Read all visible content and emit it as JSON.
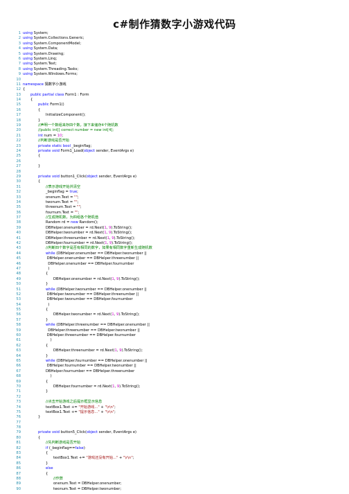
{
  "document": {
    "title": "c#制作猜数字小游戏代码"
  },
  "colors": {
    "keyword": "#0000ff",
    "comment": "#008000",
    "string": "#a31515",
    "number": "#cc00cc",
    "line_number": "#2b91af"
  },
  "code_lines": [
    {
      "n": "1",
      "indent": 0,
      "segs": [
        {
          "t": "kw",
          "v": "using"
        },
        {
          "t": "p",
          "v": " System;"
        }
      ]
    },
    {
      "n": "2",
      "indent": 0,
      "segs": [
        {
          "t": "kw",
          "v": "using"
        },
        {
          "t": "p",
          "v": " System.Collections.Generic;"
        }
      ]
    },
    {
      "n": "3",
      "indent": 0,
      "segs": [
        {
          "t": "kw",
          "v": "using"
        },
        {
          "t": "p",
          "v": " System.ComponentModel;"
        }
      ]
    },
    {
      "n": "4",
      "indent": 0,
      "segs": [
        {
          "t": "kw",
          "v": "using"
        },
        {
          "t": "p",
          "v": " System.Data;"
        }
      ]
    },
    {
      "n": "5",
      "indent": 0,
      "segs": [
        {
          "t": "kw",
          "v": "using"
        },
        {
          "t": "p",
          "v": " System.Drawing;"
        }
      ]
    },
    {
      "n": "6",
      "indent": 0,
      "segs": [
        {
          "t": "kw",
          "v": "using"
        },
        {
          "t": "p",
          "v": " System.Linq;"
        }
      ]
    },
    {
      "n": "7",
      "indent": 0,
      "segs": [
        {
          "t": "kw",
          "v": "using"
        },
        {
          "t": "p",
          "v": " System.Text;"
        }
      ]
    },
    {
      "n": "8",
      "indent": 0,
      "segs": [
        {
          "t": "kw",
          "v": "using"
        },
        {
          "t": "p",
          "v": " System.Threading.Tasks;"
        }
      ]
    },
    {
      "n": "9",
      "indent": 0,
      "segs": [
        {
          "t": "kw",
          "v": "using"
        },
        {
          "t": "p",
          "v": " System.Windows.Forms;"
        }
      ]
    },
    {
      "n": "10",
      "indent": 0,
      "segs": []
    },
    {
      "n": "11",
      "indent": 0,
      "segs": [
        {
          "t": "kw",
          "v": "namespace"
        },
        {
          "t": "p",
          "v": " 猜数字小游戏"
        }
      ]
    },
    {
      "n": "12",
      "indent": 0,
      "segs": [
        {
          "t": "p",
          "v": "{"
        }
      ]
    },
    {
      "n": "13",
      "indent": 1,
      "segs": [
        {
          "t": "kw",
          "v": "public partial class"
        },
        {
          "t": "p",
          "v": " Form1 : Form"
        }
      ]
    },
    {
      "n": "14",
      "indent": 1,
      "segs": [
        {
          "t": "p",
          "v": "{"
        }
      ]
    },
    {
      "n": "15",
      "indent": 2,
      "segs": [
        {
          "t": "kw",
          "v": "public"
        },
        {
          "t": "p",
          "v": " Form1()"
        }
      ]
    },
    {
      "n": "16",
      "indent": 2,
      "segs": [
        {
          "t": "p",
          "v": "{"
        }
      ]
    },
    {
      "n": "17",
      "indent": 3,
      "segs": [
        {
          "t": "p",
          "v": "InitializeComponent();"
        }
      ]
    },
    {
      "n": "18",
      "indent": 2,
      "segs": [
        {
          "t": "p",
          "v": "}"
        }
      ]
    },
    {
      "n": "19",
      "indent": 2,
      "segs": [
        {
          "t": "cm",
          "v": "//声明一个数组来存四个数，接下来储存4个随机数"
        }
      ]
    },
    {
      "n": "20",
      "indent": 2,
      "segs": [
        {
          "t": "cm",
          "v": "//public int[] correct number = new int[4];"
        }
      ]
    },
    {
      "n": "21",
      "indent": 2,
      "segs": [
        {
          "t": "kw",
          "v": "int"
        },
        {
          "t": "p",
          "v": " num = "
        },
        {
          "t": "num",
          "v": "10"
        },
        {
          "t": "p",
          "v": ";"
        }
      ]
    },
    {
      "n": "22",
      "indent": 2,
      "segs": [
        {
          "t": "cm",
          "v": "//判断游戏是否开始"
        }
      ]
    },
    {
      "n": "23",
      "indent": 2,
      "segs": [
        {
          "t": "kw",
          "v": "private static bool"
        },
        {
          "t": "p",
          "v": " _beginflag;"
        }
      ]
    },
    {
      "n": "24",
      "indent": 2,
      "segs": [
        {
          "t": "kw",
          "v": "private void"
        },
        {
          "t": "p",
          "v": " Form1_Load("
        },
        {
          "t": "kw",
          "v": "object"
        },
        {
          "t": "p",
          "v": " sender, EventArgs e)"
        }
      ]
    },
    {
      "n": "25",
      "indent": 2,
      "segs": [
        {
          "t": "p",
          "v": "{"
        }
      ]
    },
    {
      "n": "26",
      "indent": 0,
      "segs": []
    },
    {
      "n": "27",
      "indent": 2,
      "segs": [
        {
          "t": "p",
          "v": "}"
        }
      ]
    },
    {
      "n": "28",
      "indent": 0,
      "segs": []
    },
    {
      "n": "29",
      "indent": 2,
      "segs": [
        {
          "t": "kw",
          "v": "private void"
        },
        {
          "t": "p",
          "v": " button1_Click("
        },
        {
          "t": "kw",
          "v": "object"
        },
        {
          "t": "p",
          "v": " sender, EventArgs e)"
        }
      ]
    },
    {
      "n": "30",
      "indent": 2,
      "segs": [
        {
          "t": "p",
          "v": "{"
        }
      ]
    },
    {
      "n": "31",
      "indent": 3,
      "segs": [
        {
          "t": "cm",
          "v": "//表示游戏开始并清空"
        }
      ]
    },
    {
      "n": "32",
      "indent": 3,
      "segs": [
        {
          "t": "p",
          "v": "_beginflag = "
        },
        {
          "t": "kw",
          "v": "true"
        },
        {
          "t": "p",
          "v": ";"
        }
      ]
    },
    {
      "n": "33",
      "indent": 3,
      "segs": [
        {
          "t": "p",
          "v": "onenum.Text = "
        },
        {
          "t": "str",
          "v": "\"\""
        },
        {
          "t": "p",
          "v": ";"
        }
      ]
    },
    {
      "n": "34",
      "indent": 3,
      "segs": [
        {
          "t": "p",
          "v": "twonum.Text = "
        },
        {
          "t": "str",
          "v": "\"\""
        },
        {
          "t": "p",
          "v": ";"
        }
      ]
    },
    {
      "n": "35",
      "indent": 3,
      "segs": [
        {
          "t": "p",
          "v": "threenum.Text = "
        },
        {
          "t": "str",
          "v": "\"\""
        },
        {
          "t": "p",
          "v": ";"
        }
      ]
    },
    {
      "n": "36",
      "indent": 3,
      "segs": [
        {
          "t": "p",
          "v": "fournum.Text = "
        },
        {
          "t": "str",
          "v": "\"\""
        },
        {
          "t": "p",
          "v": ";"
        }
      ]
    },
    {
      "n": "37",
      "indent": 3,
      "segs": [
        {
          "t": "cm",
          "v": "//生成随机数，为四组各个随机值"
        }
      ]
    },
    {
      "n": "38",
      "indent": 3,
      "segs": [
        {
          "t": "p",
          "v": "Random rd = "
        },
        {
          "t": "kw",
          "v": "new"
        },
        {
          "t": "p",
          "v": " Random();"
        }
      ]
    },
    {
      "n": "39",
      "indent": 3,
      "segs": [
        {
          "t": "p",
          "v": "DBHelper.onenumber = rd.Next("
        },
        {
          "t": "num",
          "v": "1"
        },
        {
          "t": "p",
          "v": ", "
        },
        {
          "t": "num",
          "v": "9"
        },
        {
          "t": "p",
          "v": ").ToString();"
        }
      ]
    },
    {
      "n": "40",
      "indent": 3,
      "segs": [
        {
          "t": "p",
          "v": "DBHelper.twonumber = rd.Next("
        },
        {
          "t": "num",
          "v": "1"
        },
        {
          "t": "p",
          "v": ", "
        },
        {
          "t": "num",
          "v": "9"
        },
        {
          "t": "p",
          "v": ").ToString();"
        }
      ]
    },
    {
      "n": "41",
      "indent": 3,
      "segs": [
        {
          "t": "p",
          "v": "DBHelper.threenumber = rd.Next("
        },
        {
          "t": "num",
          "v": "1"
        },
        {
          "t": "p",
          "v": ", "
        },
        {
          "t": "num",
          "v": "9"
        },
        {
          "t": "p",
          "v": ").ToString();"
        }
      ]
    },
    {
      "n": "42",
      "indent": 3,
      "segs": [
        {
          "t": "p",
          "v": "DBHelper.fournumber = rd.Next("
        },
        {
          "t": "num",
          "v": "1"
        },
        {
          "t": "p",
          "v": ", "
        },
        {
          "t": "num",
          "v": "9"
        },
        {
          "t": "p",
          "v": ").ToString();"
        }
      ]
    },
    {
      "n": "43",
      "indent": 3,
      "segs": [
        {
          "t": "cm",
          "v": "//判断四个数字是否有相同的数字，如果有相同数字重新生成随机数"
        }
      ]
    },
    {
      "n": "44",
      "indent": 3,
      "segs": [
        {
          "t": "kw",
          "v": "while"
        },
        {
          "t": "p",
          "v": " (DBHelper.onenumber == DBHelper.twonumber ||"
        }
      ]
    },
    {
      "n": "45",
      "indent": 3,
      "segs": [
        {
          "t": "p",
          "v": " DBHelper.onenumber == DBHelper.threenumber ||"
        }
      ]
    },
    {
      "n": "46",
      "indent": 3,
      "segs": [
        {
          "t": "p",
          "v": "  DBHelper.onenumber == DBHelper.fournumber"
        }
      ]
    },
    {
      "n": "47",
      "indent": 3,
      "segs": [
        {
          "t": "p",
          "v": "  )"
        }
      ]
    },
    {
      "n": "48",
      "indent": 3,
      "segs": [
        {
          "t": "p",
          "v": "{"
        }
      ]
    },
    {
      "n": "49",
      "indent": 4,
      "segs": [
        {
          "t": "p",
          "v": "DBHelper.onenumber = rd.Next("
        },
        {
          "t": "num",
          "v": "1"
        },
        {
          "t": "p",
          "v": ", "
        },
        {
          "t": "num",
          "v": "9"
        },
        {
          "t": "p",
          "v": ").ToString();"
        }
      ]
    },
    {
      "n": "50",
      "indent": 3,
      "segs": [
        {
          "t": "p",
          "v": "}"
        }
      ]
    },
    {
      "n": "51",
      "indent": 3,
      "segs": [
        {
          "t": "kw",
          "v": "while"
        },
        {
          "t": "p",
          "v": " (DBHelper.twonumber == DBHelper.onenumber ||"
        }
      ]
    },
    {
      "n": "52",
      "indent": 3,
      "segs": [
        {
          "t": "p",
          "v": " DBHelper.twonumber == DBHelper.threenumber ||"
        }
      ]
    },
    {
      "n": "53",
      "indent": 3,
      "segs": [
        {
          "t": "p",
          "v": " DBHelper.twonumber == DBHelper.fournumber"
        }
      ]
    },
    {
      "n": "54",
      "indent": 3,
      "segs": [
        {
          "t": "p",
          "v": "  )"
        }
      ]
    },
    {
      "n": "55",
      "indent": 3,
      "segs": [
        {
          "t": "p",
          "v": "{"
        }
      ]
    },
    {
      "n": "56",
      "indent": 4,
      "segs": [
        {
          "t": "p",
          "v": "DBHelper.twonumber = rd.Next("
        },
        {
          "t": "num",
          "v": "1"
        },
        {
          "t": "p",
          "v": ", "
        },
        {
          "t": "num",
          "v": "9"
        },
        {
          "t": "p",
          "v": ").ToString();"
        }
      ]
    },
    {
      "n": "57",
      "indent": 3,
      "segs": [
        {
          "t": "p",
          "v": "}"
        }
      ]
    },
    {
      "n": "58",
      "indent": 3,
      "segs": [
        {
          "t": "kw",
          "v": "while"
        },
        {
          "t": "p",
          "v": " (DBHelper.threenumber == DBHelper.onenumber ||"
        }
      ]
    },
    {
      "n": "59",
      "indent": 3,
      "segs": [
        {
          "t": "p",
          "v": "  DBHelper.threenumber == DBHelper.twonumber ||"
        }
      ]
    },
    {
      "n": "60",
      "indent": 3,
      "segs": [
        {
          "t": "p",
          "v": " DBHelper.threenumber == DBHelper.fournumber"
        }
      ]
    },
    {
      "n": "61",
      "indent": 3,
      "segs": [
        {
          "t": "p",
          "v": "    )"
        }
      ]
    },
    {
      "n": "62",
      "indent": 3,
      "segs": [
        {
          "t": "p",
          "v": "{"
        }
      ]
    },
    {
      "n": "63",
      "indent": 4,
      "segs": [
        {
          "t": "p",
          "v": "DBHelper.threenumber = rd.Next("
        },
        {
          "t": "num",
          "v": "1"
        },
        {
          "t": "p",
          "v": ", "
        },
        {
          "t": "num",
          "v": "9"
        },
        {
          "t": "p",
          "v": ").ToString();"
        }
      ]
    },
    {
      "n": "64",
      "indent": 3,
      "segs": [
        {
          "t": "p",
          "v": "}"
        }
      ]
    },
    {
      "n": "65",
      "indent": 3,
      "segs": [
        {
          "t": "kw",
          "v": "while"
        },
        {
          "t": "p",
          "v": " (DBHelper.fournumber == DBHelper.onenumber ||"
        }
      ]
    },
    {
      "n": "66",
      "indent": 3,
      "segs": [
        {
          "t": "p",
          "v": " DBHelper.fournumber == DBHelper.twonumber ||"
        }
      ]
    },
    {
      "n": "67",
      "indent": 3,
      "segs": [
        {
          "t": "p",
          "v": "DBHelper.fournumber == DBHelper.threenumber"
        }
      ]
    },
    {
      "n": "68",
      "indent": 3,
      "segs": [
        {
          "t": "p",
          "v": "    )"
        }
      ]
    },
    {
      "n": "69",
      "indent": 3,
      "segs": [
        {
          "t": "p",
          "v": "{"
        }
      ]
    },
    {
      "n": "70",
      "indent": 4,
      "segs": [
        {
          "t": "p",
          "v": "DBHelper.fournumber = rd.Next("
        },
        {
          "t": "num",
          "v": "1"
        },
        {
          "t": "p",
          "v": ", "
        },
        {
          "t": "num",
          "v": "9"
        },
        {
          "t": "p",
          "v": ").ToString();"
        }
      ]
    },
    {
      "n": "71",
      "indent": 3,
      "segs": [
        {
          "t": "p",
          "v": "}"
        }
      ]
    },
    {
      "n": "72",
      "indent": 0,
      "segs": []
    },
    {
      "n": "73",
      "indent": 3,
      "segs": [
        {
          "t": "cm",
          "v": "//点击开始游戏之后提示框显示信息"
        }
      ]
    },
    {
      "n": "74",
      "indent": 3,
      "segs": [
        {
          "t": "p",
          "v": "textBox1.Text += "
        },
        {
          "t": "str",
          "v": "\"开始游戏...\""
        },
        {
          "t": "p",
          "v": " + "
        },
        {
          "t": "str",
          "v": "\"\\r\\n\""
        },
        {
          "t": "p",
          "v": ";"
        }
      ]
    },
    {
      "n": "75",
      "indent": 3,
      "segs": [
        {
          "t": "p",
          "v": "textBox1.Text += "
        },
        {
          "t": "str",
          "v": "\"提示信息...\""
        },
        {
          "t": "p",
          "v": " + "
        },
        {
          "t": "str",
          "v": "\"\\r\\n\""
        },
        {
          "t": "p",
          "v": ";"
        }
      ]
    },
    {
      "n": "76",
      "indent": 2,
      "segs": [
        {
          "t": "p",
          "v": "}"
        }
      ]
    },
    {
      "n": "77",
      "indent": 0,
      "segs": []
    },
    {
      "n": "78",
      "indent": 0,
      "segs": []
    },
    {
      "n": "79",
      "indent": 2,
      "segs": [
        {
          "t": "kw",
          "v": "private void"
        },
        {
          "t": "p",
          "v": " button5_Click("
        },
        {
          "t": "kw",
          "v": "object"
        },
        {
          "t": "p",
          "v": " sender, EventArgs e)"
        }
      ]
    },
    {
      "n": "80",
      "indent": 2,
      "segs": [
        {
          "t": "p",
          "v": "{"
        }
      ]
    },
    {
      "n": "81",
      "indent": 3,
      "segs": [
        {
          "t": "cm",
          "v": "//先判断游戏是否开始"
        }
      ]
    },
    {
      "n": "82",
      "indent": 3,
      "segs": [
        {
          "t": "kw",
          "v": "if"
        },
        {
          "t": "p",
          "v": " (_beginflag=="
        },
        {
          "t": "kw",
          "v": "false"
        },
        {
          "t": "p",
          "v": ")"
        }
      ]
    },
    {
      "n": "83",
      "indent": 3,
      "segs": [
        {
          "t": "p",
          "v": "{"
        }
      ]
    },
    {
      "n": "84",
      "indent": 4,
      "segs": [
        {
          "t": "p",
          "v": "textBox1.Text += "
        },
        {
          "t": "str",
          "v": "\"游戏还没有开始...\""
        },
        {
          "t": "p",
          "v": " + "
        },
        {
          "t": "str",
          "v": "\"\\r\\n\""
        },
        {
          "t": "p",
          "v": ";"
        }
      ]
    },
    {
      "n": "85",
      "indent": 3,
      "segs": [
        {
          "t": "p",
          "v": "}"
        }
      ]
    },
    {
      "n": "86",
      "indent": 3,
      "segs": [
        {
          "t": "kw",
          "v": "else"
        }
      ]
    },
    {
      "n": "87",
      "indent": 3,
      "segs": [
        {
          "t": "p",
          "v": "{"
        }
      ]
    },
    {
      "n": "88",
      "indent": 4,
      "segs": [
        {
          "t": "cm",
          "v": "//作弊"
        }
      ]
    },
    {
      "n": "89",
      "indent": 4,
      "segs": [
        {
          "t": "p",
          "v": "onenum.Text = DBHelper.onenumber;"
        }
      ]
    },
    {
      "n": "90",
      "indent": 4,
      "segs": [
        {
          "t": "p",
          "v": "twonum.Text = DBHelper.twonumber;"
        }
      ]
    }
  ]
}
